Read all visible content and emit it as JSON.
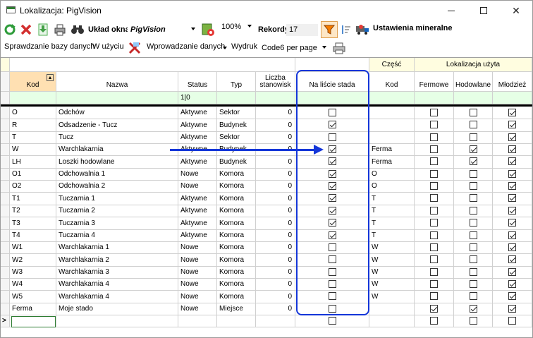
{
  "window": {
    "title": "Lokalizacja: PigVision"
  },
  "toolbar1": {
    "layout_label": "Układ okna",
    "layout_value": "PigVision",
    "zoom_value": "100%",
    "records_label": "Rekordy",
    "records_value": "17",
    "mineral_label": "Ustawienia mineralne"
  },
  "toolbar2": {
    "check_db": "Sprawdzanie bazy danych",
    "in_use": "W użyciu",
    "data_entry": "Wprowadzanie danych",
    "print_label": "Wydruk",
    "print_value": "Code6 per page"
  },
  "grid": {
    "group_czesc": "Część",
    "group_lokalizacja": "Lokalizacja użyta",
    "columns": {
      "kod": "Kod",
      "nazwa": "Nazwa",
      "status": "Status",
      "typ": "Typ",
      "liczba": "Liczba stanowisk",
      "na_liscie": "Na liście stada",
      "czesc_kod": "Kod",
      "fermowe": "Fermowe",
      "hodowlane": "Hodowlane",
      "mlodziez": "Młodzież"
    },
    "filter_status": "1|0",
    "rows": [
      {
        "kod": "O",
        "nazwa": "Odchów",
        "status": "Aktywne",
        "typ": "Sektor",
        "liczba": "0",
        "na": false,
        "ck": "",
        "f": false,
        "h": false,
        "m": true
      },
      {
        "kod": "R",
        "nazwa": "Odsadzenie - Tucz",
        "status": "Aktywne",
        "typ": "Budynek",
        "liczba": "0",
        "na": true,
        "ck": "",
        "f": false,
        "h": false,
        "m": true
      },
      {
        "kod": "T",
        "nazwa": "Tucz",
        "status": "Aktywne",
        "typ": "Sektor",
        "liczba": "0",
        "na": false,
        "ck": "",
        "f": false,
        "h": false,
        "m": true
      },
      {
        "kod": "W",
        "nazwa": "Warchlakarnia",
        "status": "Aktywne",
        "typ": "Budynek",
        "liczba": "0",
        "na": true,
        "ck": "Ferma",
        "f": false,
        "h": true,
        "m": true
      },
      {
        "kod": "LH",
        "nazwa": "Loszki hodowlane",
        "status": "Aktywne",
        "typ": "Budynek",
        "liczba": "0",
        "na": true,
        "ck": "Ferma",
        "f": false,
        "h": true,
        "m": true
      },
      {
        "kod": "O1",
        "nazwa": "Odchowalnia 1",
        "status": "Nowe",
        "typ": "Komora",
        "liczba": "0",
        "na": true,
        "ck": "O",
        "f": false,
        "h": false,
        "m": true
      },
      {
        "kod": "O2",
        "nazwa": "Odchowalnia 2",
        "status": "Nowe",
        "typ": "Komora",
        "liczba": "0",
        "na": true,
        "ck": "O",
        "f": false,
        "h": false,
        "m": true
      },
      {
        "kod": "T1",
        "nazwa": "Tuczarnia 1",
        "status": "Aktywne",
        "typ": "Komora",
        "liczba": "0",
        "na": true,
        "ck": "T",
        "f": false,
        "h": false,
        "m": true
      },
      {
        "kod": "T2",
        "nazwa": "Tuczarnia 2",
        "status": "Aktywne",
        "typ": "Komora",
        "liczba": "0",
        "na": true,
        "ck": "T",
        "f": false,
        "h": false,
        "m": true
      },
      {
        "kod": "T3",
        "nazwa": "Tuczarnia 3",
        "status": "Aktywne",
        "typ": "Komora",
        "liczba": "0",
        "na": true,
        "ck": "T",
        "f": false,
        "h": false,
        "m": true
      },
      {
        "kod": "T4",
        "nazwa": "Tuczarnia 4",
        "status": "Aktywne",
        "typ": "Komora",
        "liczba": "0",
        "na": true,
        "ck": "T",
        "f": false,
        "h": false,
        "m": true
      },
      {
        "kod": "W1",
        "nazwa": "Warchlakarnia 1",
        "status": "Nowe",
        "typ": "Komora",
        "liczba": "0",
        "na": false,
        "ck": "W",
        "f": false,
        "h": false,
        "m": true
      },
      {
        "kod": "W2",
        "nazwa": "Warchlakarnia 2",
        "status": "Nowe",
        "typ": "Komora",
        "liczba": "0",
        "na": false,
        "ck": "W",
        "f": false,
        "h": false,
        "m": true
      },
      {
        "kod": "W3",
        "nazwa": "Warchlakarnia 3",
        "status": "Nowe",
        "typ": "Komora",
        "liczba": "0",
        "na": false,
        "ck": "W",
        "f": false,
        "h": false,
        "m": true
      },
      {
        "kod": "W4",
        "nazwa": "Warchlakarnia 4",
        "status": "Nowe",
        "typ": "Komora",
        "liczba": "0",
        "na": false,
        "ck": "W",
        "f": false,
        "h": false,
        "m": true
      },
      {
        "kod": "W5",
        "nazwa": "Warchlakarnia 4",
        "status": "Nowe",
        "typ": "Komora",
        "liczba": "0",
        "na": false,
        "ck": "W",
        "f": false,
        "h": false,
        "m": true
      },
      {
        "kod": "Ferma",
        "nazwa": "Moje stado",
        "status": "Nowe",
        "typ": "Miejsce",
        "liczba": "0",
        "na": false,
        "ck": "",
        "f": true,
        "h": true,
        "m": true
      }
    ],
    "new_row_marker": ">"
  }
}
